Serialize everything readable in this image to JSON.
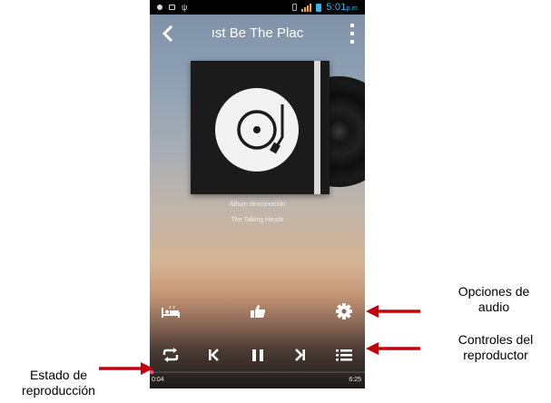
{
  "app": {
    "song_title": "ıst Be The Plac",
    "album": "Álbum desconocido",
    "artist": "The Talking Heads"
  },
  "status_bar": {
    "time": "5:01",
    "ampm": "p.m."
  },
  "playback": {
    "elapsed": "0:04",
    "duration": "6:25",
    "progress_fraction": 0.0104
  },
  "annotations": {
    "audio_options_line1": "Opciones de",
    "audio_options_line2": "audio",
    "player_controls_line1": "Controles del",
    "player_controls_line2": "reproductor",
    "playback_state_line1": "Estado de",
    "playback_state_line2": "reproducción"
  },
  "colors": {
    "accent": "#e44d6c",
    "status_time": "#33b5e5",
    "annotation_arrow": "#c0000c"
  },
  "icons": {
    "back": "chevron-left-icon",
    "menu": "overflow-menu-icon",
    "sleep": "sleep-timer-icon",
    "like": "thumbs-up-icon",
    "audio_settings": "gear-icon",
    "repeat": "repeat-icon",
    "previous": "previous-icon",
    "pause": "pause-icon",
    "next": "next-icon",
    "playlist": "playlist-icon"
  }
}
